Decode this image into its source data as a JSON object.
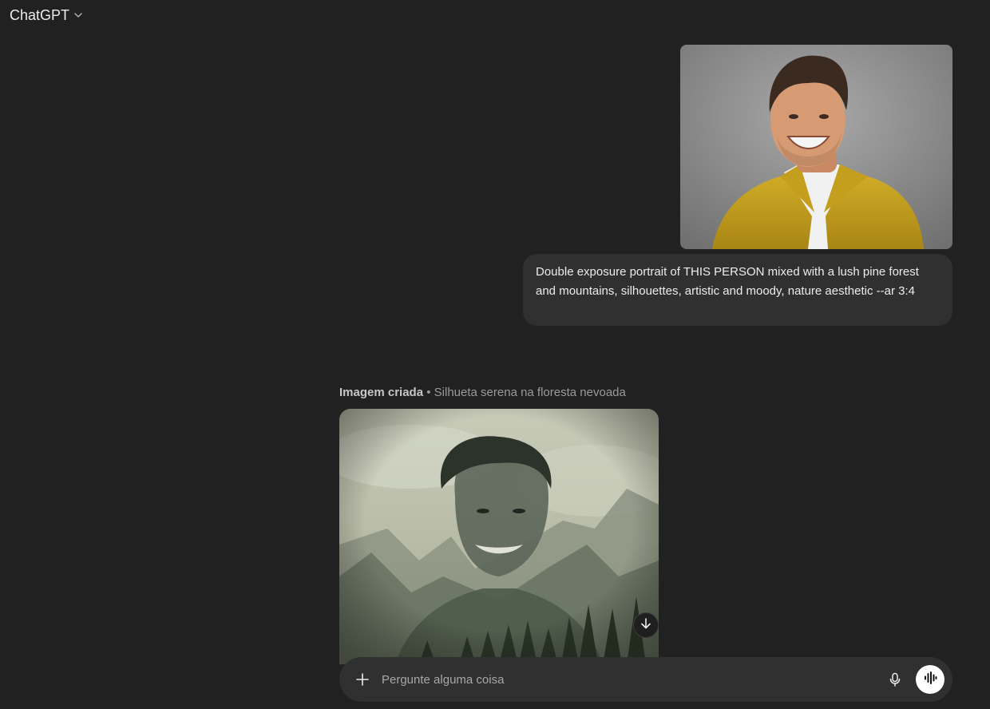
{
  "header": {
    "title": "ChatGPT",
    "chevron_icon": "chevron-down-icon"
  },
  "conversation": {
    "user_message": {
      "attachment": "portrait photo of smiling man in yellow jacket",
      "text": "Double exposure portrait of THIS PERSON mixed with a lush pine forest and mountains, silhouettes, artistic and moody, nature aesthetic --ar 3:4"
    },
    "assistant_message": {
      "label_strong": "Imagem criada",
      "label_separator": "•",
      "label_title": "Silhueta serena na floresta nevoada",
      "download_icon": "arrow-down-icon"
    }
  },
  "composer": {
    "placeholder": "Pergunte alguma coisa",
    "plus_icon": "plus-icon",
    "mic_icon": "microphone-icon",
    "voice_icon": "voice-waveform-icon"
  },
  "colors": {
    "background": "#212121",
    "bubble": "#303030",
    "text": "#ececec",
    "muted": "#9b9b9b"
  }
}
